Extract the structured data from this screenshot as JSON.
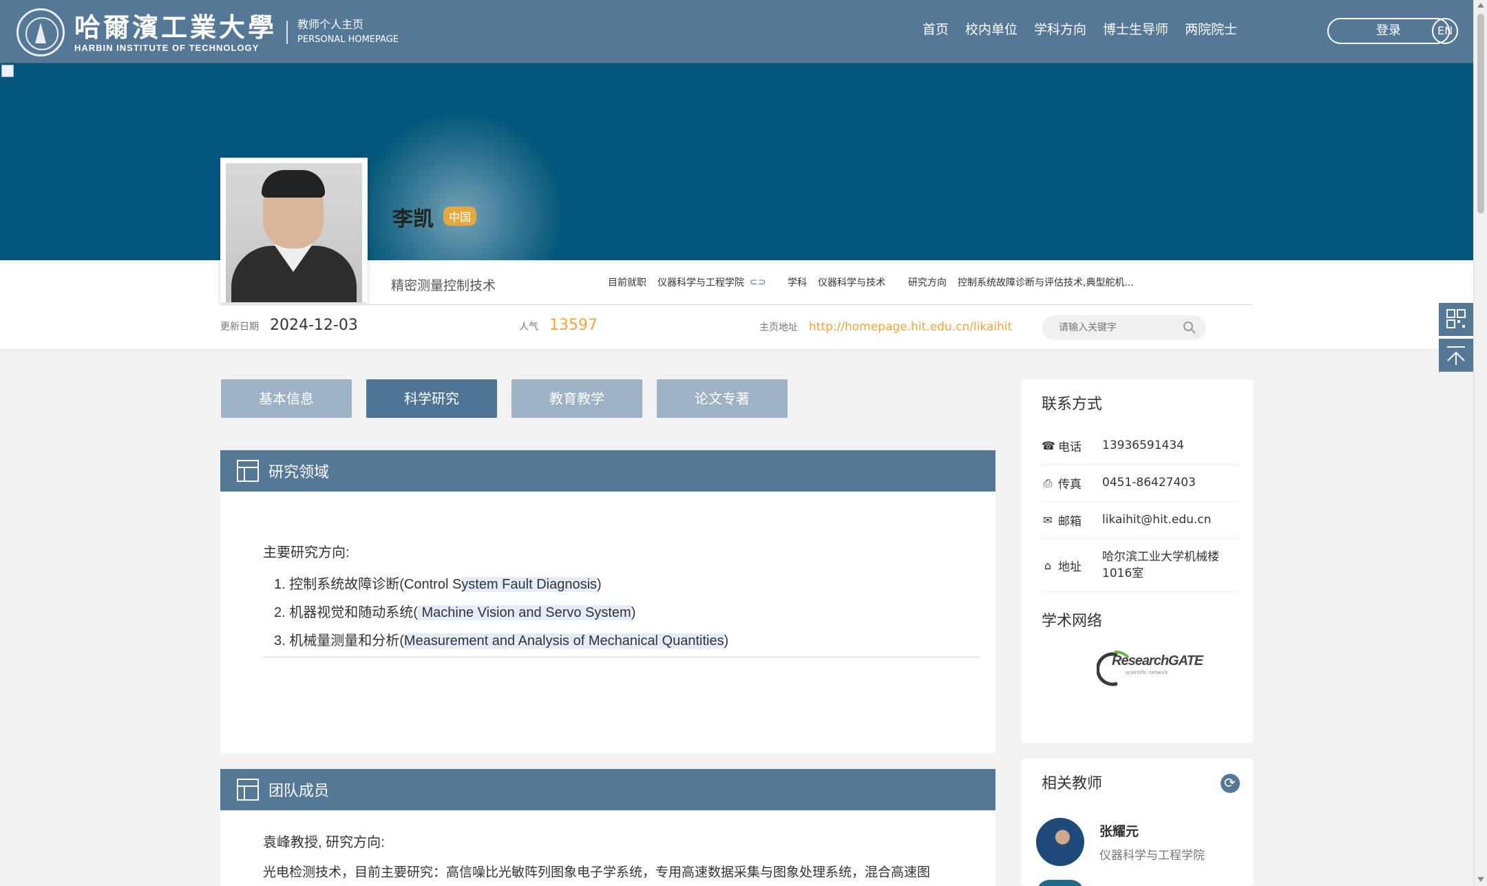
{
  "header": {
    "logo_cn": "哈爾濱工業大學",
    "logo_en": "HARBIN INSTITUTE OF TECHNOLOGY",
    "sub_cn": "教师个人主页",
    "sub_en": "PERSONAL HOMEPAGE",
    "nav": [
      "首页",
      "校内单位",
      "学科方向",
      "博士生导师",
      "两院院士"
    ],
    "login_label": "登录",
    "lang_label": "EN"
  },
  "profile": {
    "name": "李凯",
    "badge": "中国",
    "major": "精密测量控制技术",
    "current_post_label": "目前就职",
    "current_post_value": "仪器科学与工程学院",
    "discipline_label": "学科",
    "discipline_value": "仪器科学与技术",
    "research_label": "研究方向",
    "research_value": "控制系统故障诊断与评估技术,典型舵机..."
  },
  "stats": {
    "update_label": "更新日期",
    "update_value": "2024-12-03",
    "popularity_label": "人气",
    "popularity_value": "13597",
    "homepage_label": "主页地址",
    "homepage_value": "http://homepage.hit.edu.cn/likaihit"
  },
  "search": {
    "placeholder": "请输入关键字"
  },
  "tabs": [
    "基本信息",
    "科学研究",
    "教育教学",
    "论文专著"
  ],
  "research_panel": {
    "title": "研究领域",
    "intro": "主要研究方向:",
    "items": [
      {
        "num": "1. ",
        "cn": "控制系统故障诊断(Control S",
        "en": "ystem Fault Diagnosis",
        "end": ")"
      },
      {
        "num": "2. ",
        "cn": "机器视觉和随动系统(",
        "en": " Machine Vision and Servo System",
        "end": ")"
      },
      {
        "num": "3. ",
        "cn": "机械量测量和分析(",
        "en": "Measurement and Analysis of Mechanical Quantities",
        "end": ")"
      }
    ]
  },
  "team_panel": {
    "title": "团队成员",
    "line1": "袁峰教授, 研究方向:",
    "line2": "光电检测技术，目前主要研究：高信噪比光敏阵列图象电子学系统，专用高速数据采集与图象处理系统，混合高速图"
  },
  "contact": {
    "title": "联系方式",
    "rows": [
      {
        "label": "电话",
        "value": "13936591434",
        "icon": "phone-icon"
      },
      {
        "label": "传真",
        "value": "0451-86427403",
        "icon": "fax-icon"
      },
      {
        "label": "邮箱",
        "value": "likaihit@hit.edu.cn",
        "icon": "mail-icon"
      },
      {
        "label": "地址",
        "value": "哈尔滨工业大学机械楼1016室",
        "icon": "home-icon"
      }
    ],
    "network_title": "学术网络",
    "rg_text": "ResearchGATE",
    "rg_sub": "scientific network"
  },
  "related": {
    "title": "相关教师",
    "teacher_name": "张耀元",
    "teacher_dept": "仪器科学与工程学院"
  },
  "colors": {
    "header": "#557897",
    "banner": "#04577b",
    "accent": "#f3a53a",
    "tab_active": "#4f7594",
    "tab": "#9db2c5"
  }
}
